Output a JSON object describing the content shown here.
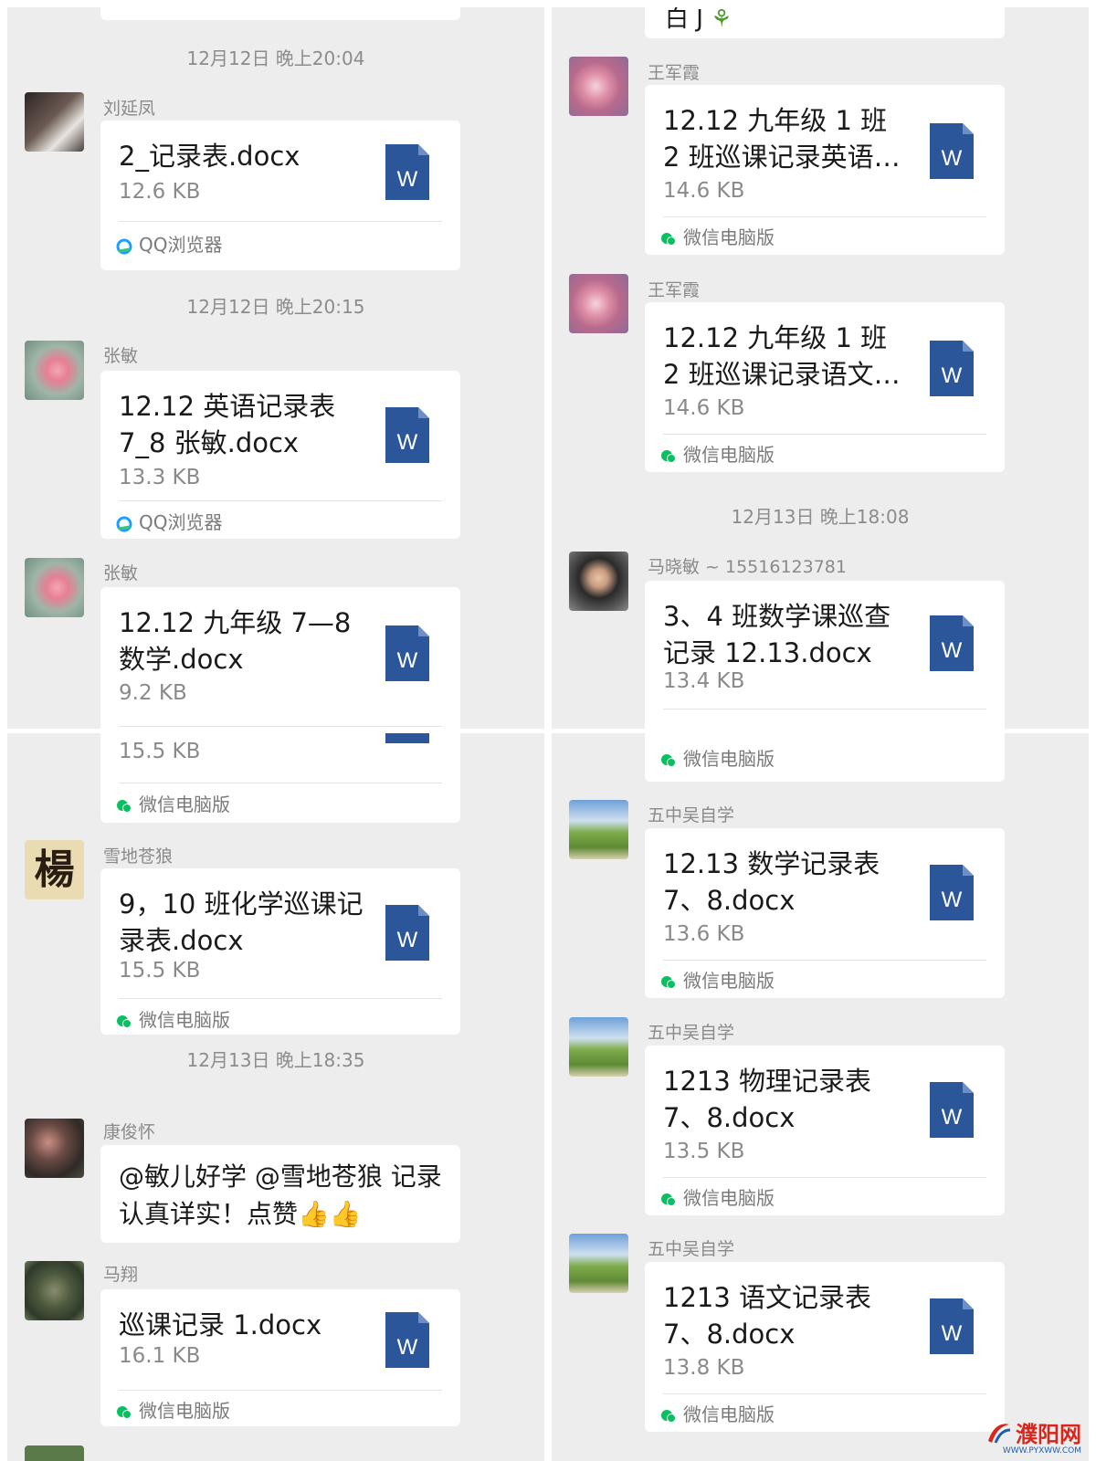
{
  "panels": {
    "top_left": {
      "timestamps": [
        "12月12日 晚上20:04",
        "12月12日 晚上20:15"
      ],
      "messages": [
        {
          "sender": "刘延凤",
          "title": "2_记录表.docx",
          "size": "12.6 KB",
          "source": "QQ浏览器"
        },
        {
          "sender": "张敏",
          "title": "12.12 英语记录表 7_8 张敏.docx",
          "size": "13.3 KB",
          "source": "QQ浏览器"
        },
        {
          "sender": "张敏",
          "title": "12.12 九年级 7—8 数学.docx",
          "size": "9.2 KB",
          "source": ""
        }
      ]
    },
    "top_right": {
      "fragment_text": "白 J",
      "timestamps": [
        "12月13日 晚上18:08"
      ],
      "messages": [
        {
          "sender": "王军霞",
          "title": "12.12 九年级 1 班 2 班巡课记录英语…",
          "size": "14.6 KB",
          "source": "微信电脑版"
        },
        {
          "sender": "王军霞",
          "title": "12.12 九年级 1 班 2 班巡课记录语文…",
          "size": "14.6 KB",
          "source": "微信电脑版"
        },
        {
          "sender": "马晓敏 ~ 15516123781",
          "title": "3、4 班数学课巡查记录 12.13.docx",
          "size": "13.4 KB",
          "source": "微信电脑版"
        }
      ]
    },
    "bottom_left": {
      "partial_size": "15.5 KB",
      "partial_source": "微信电脑版",
      "timestamps": [
        "12月13日 晚上18:35"
      ],
      "messages": [
        {
          "sender": "雪地苍狼",
          "title": "9，10 班化学巡课记录表.docx",
          "size": "15.5 KB",
          "source": "微信电脑版"
        },
        {
          "sender": "康俊怀",
          "text": "@敏儿好学 @雪地苍狼  记录认真详实！点赞👍👍"
        },
        {
          "sender": "马翔",
          "title": "巡课记录 1.docx",
          "size": "16.1 KB",
          "source": "微信电脑版"
        }
      ]
    },
    "bottom_right": {
      "partial_source": "微信电脑版",
      "messages": [
        {
          "sender": "五中吴自学",
          "title": "12.13 数学记录表 7、8.docx",
          "size": "13.6 KB",
          "source": "微信电脑版"
        },
        {
          "sender": "五中吴自学",
          "title": "1213 物理记录表 7、8.docx",
          "size": "13.5 KB",
          "source": "微信电脑版"
        },
        {
          "sender": "五中吴自学",
          "title": "1213 语文记录表 7、8.docx",
          "size": "13.8 KB",
          "source": "微信电脑版"
        }
      ]
    }
  },
  "doc_icon_letter": "W",
  "avatar_glyph_xuedi": "楊",
  "watermark": {
    "name": "濮阳网",
    "url": "WWW.PYXWW.COM"
  },
  "colors": {
    "doc_blue": "#2b579a",
    "chat_bg": "#ededed",
    "wechat_green": "#07c160",
    "qq_blue": "#1e9fff",
    "watermark_red": "#d9261c"
  }
}
